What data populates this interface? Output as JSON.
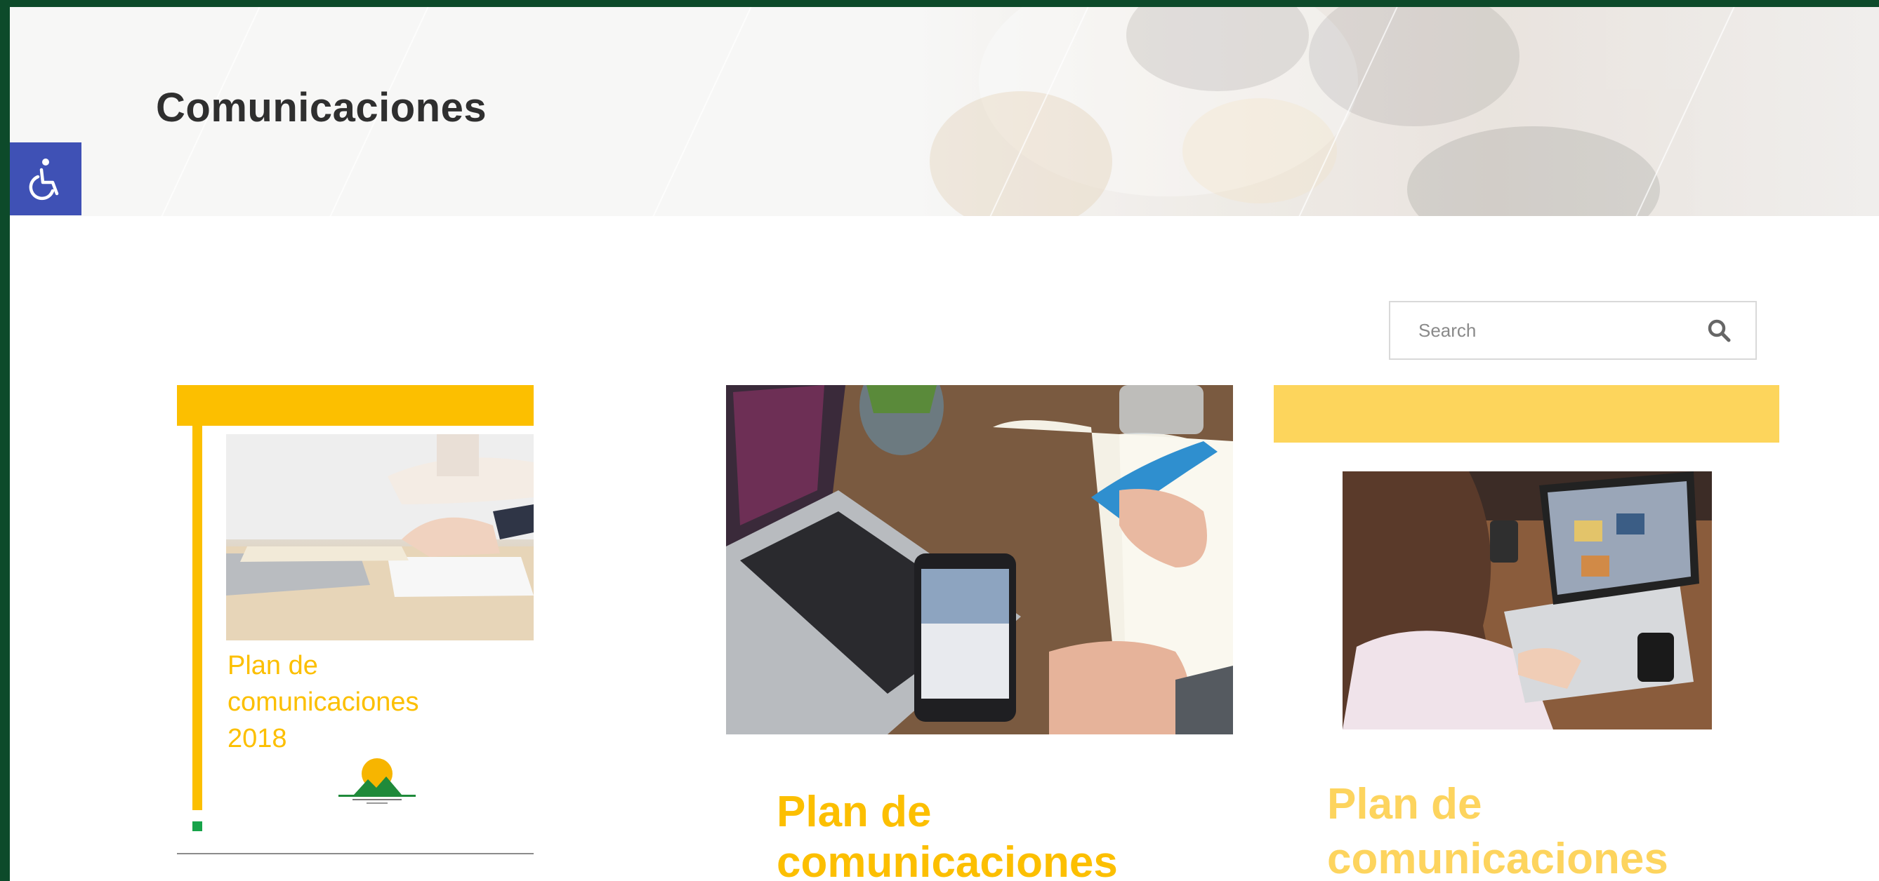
{
  "header": {
    "title": "Comunicaciones"
  },
  "accessibility": {
    "icon": "wheelchair-icon",
    "bg_color": "#3f51b5"
  },
  "search": {
    "placeholder": "Search",
    "value": "",
    "icon": "search-icon"
  },
  "cards": [
    {
      "bar_color": "#fcbf00",
      "lines": [
        "Plan de",
        "comunicaciones",
        "2018"
      ],
      "icon": "mountain-sun-logo-icon"
    },
    {
      "title_lines": [
        "Plan de",
        "comunicaciones"
      ],
      "image": "laptop-phone-notebook-photo"
    },
    {
      "bar_color": "#fdd55c",
      "title_lines": [
        "Plan de",
        "comunicaciones"
      ],
      "image": "woman-laptop-photo"
    }
  ],
  "colors": {
    "frame": "#0d4a2a",
    "accent_yellow": "#fcbf00",
    "title_text": "#2f2f2f"
  }
}
